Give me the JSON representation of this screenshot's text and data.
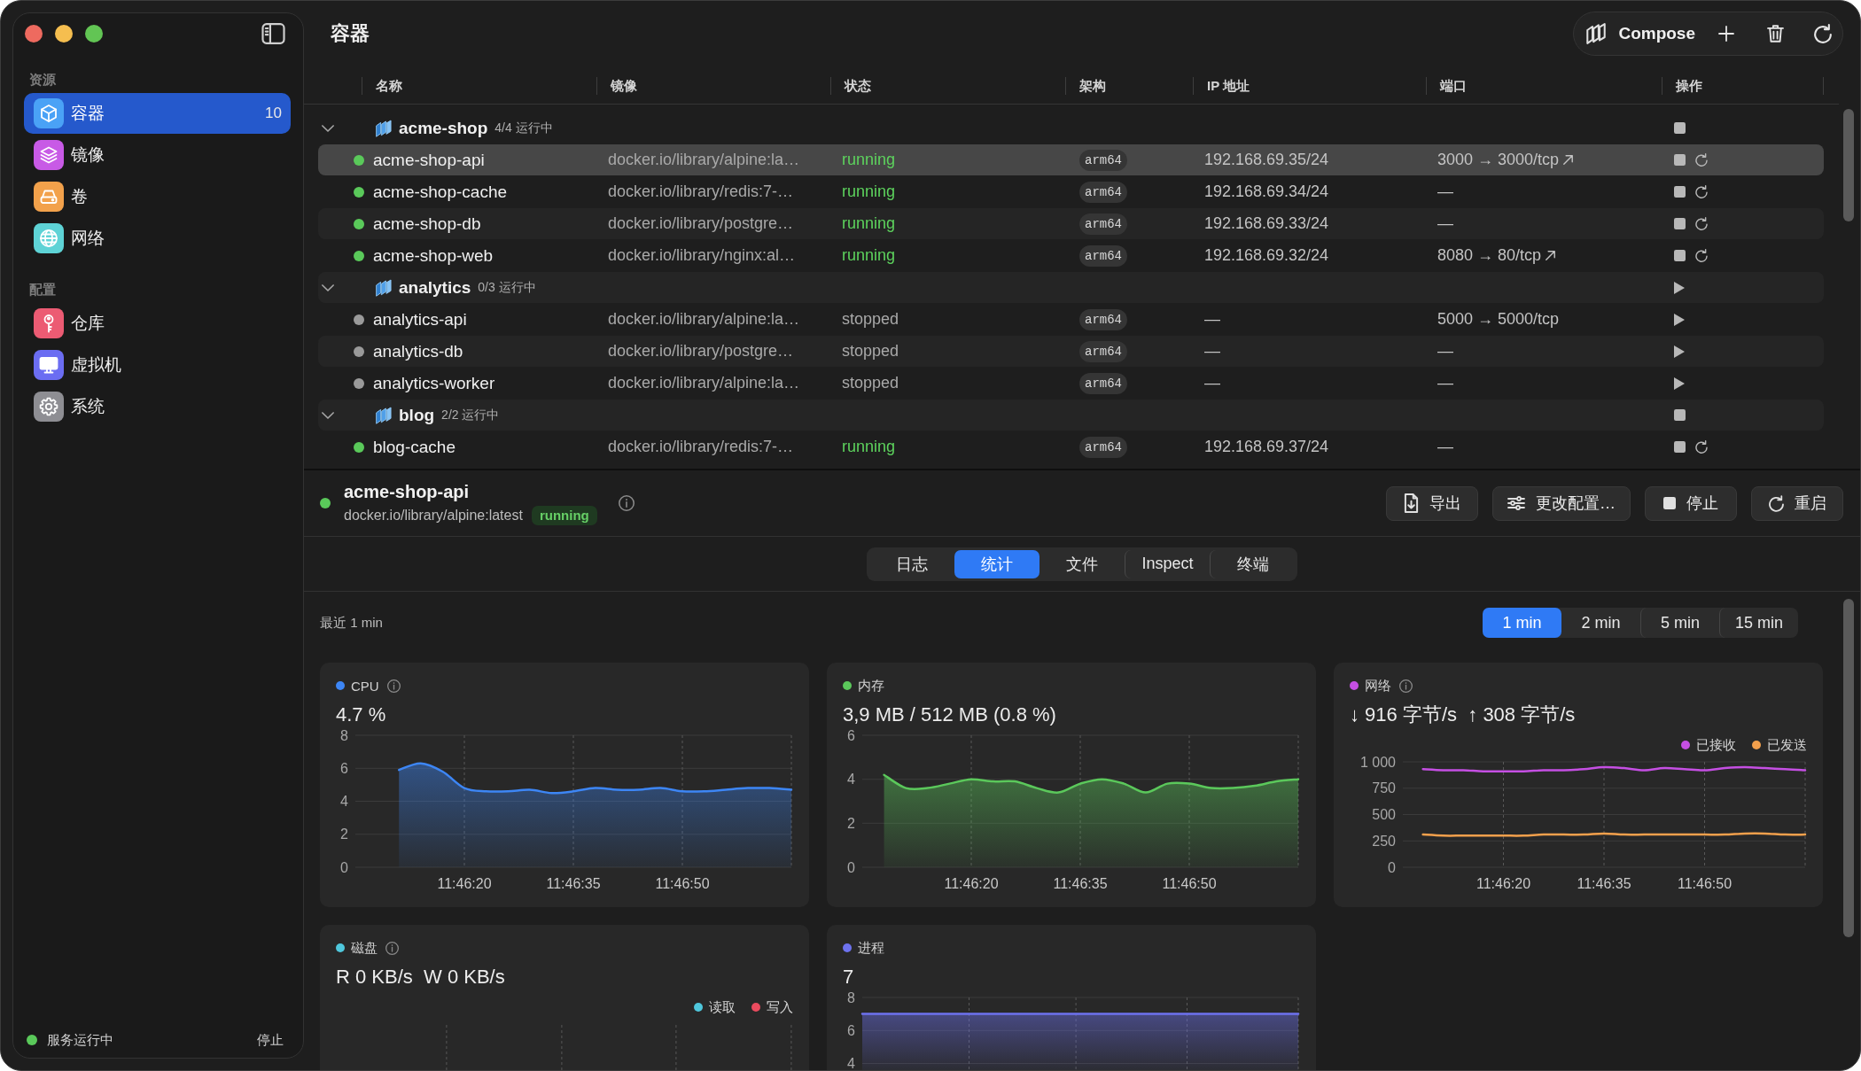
{
  "window": {
    "title": "容器"
  },
  "sidebar": {
    "sections": [
      {
        "label": "资源",
        "items": [
          {
            "label": "容器",
            "count": "10",
            "selected": true,
            "color": "#4aa2f6"
          },
          {
            "label": "镜像",
            "selected": false,
            "color": "#c85ae6"
          },
          {
            "label": "卷",
            "selected": false,
            "color": "#f2a14b"
          },
          {
            "label": "网络",
            "selected": false,
            "color": "#5ed3d6"
          }
        ]
      },
      {
        "label": "配置",
        "items": [
          {
            "label": "仓库",
            "selected": false,
            "color": "#ec5b73"
          },
          {
            "label": "虚拟机",
            "selected": false,
            "color": "#6b6df2"
          },
          {
            "label": "系统",
            "selected": false,
            "color": "#8e8e93"
          }
        ]
      }
    ],
    "status": {
      "text": "服务运行中",
      "running": true,
      "action": "停止"
    }
  },
  "toolbar": {
    "compose": "Compose"
  },
  "table": {
    "columns": [
      "名称",
      "镜像",
      "状态",
      "架构",
      "IP 地址",
      "端口",
      "操作"
    ],
    "groups": [
      {
        "name": "acme-shop",
        "summary": "4/4 运行中",
        "expanded": true,
        "running": true,
        "selected": false,
        "children": [
          {
            "name": "acme-shop-api",
            "image": "docker.io/library/alpine:la…",
            "status": "running",
            "running": true,
            "arch": "arm64",
            "ip": "192.168.69.35/24",
            "port": "3000 → 3000/tcp",
            "port_link": true,
            "selected": true
          },
          {
            "name": "acme-shop-cache",
            "image": "docker.io/library/redis:7-…",
            "status": "running",
            "running": true,
            "arch": "arm64",
            "ip": "192.168.69.34/24",
            "port": "—",
            "port_link": false,
            "selected": false
          },
          {
            "name": "acme-shop-db",
            "image": "docker.io/library/postgre…",
            "status": "running",
            "running": true,
            "arch": "arm64",
            "ip": "192.168.69.33/24",
            "port": "—",
            "port_link": false,
            "selected": false
          },
          {
            "name": "acme-shop-web",
            "image": "docker.io/library/nginx:al…",
            "status": "running",
            "running": true,
            "arch": "arm64",
            "ip": "192.168.69.32/24",
            "port": "8080 → 80/tcp",
            "port_link": true,
            "selected": false
          }
        ]
      },
      {
        "name": "analytics",
        "summary": "0/3 运行中",
        "expanded": true,
        "running": false,
        "selected": false,
        "children": [
          {
            "name": "analytics-api",
            "image": "docker.io/library/alpine:la…",
            "status": "stopped",
            "running": false,
            "arch": "arm64",
            "ip": "—",
            "port": "5000 → 5000/tcp",
            "port_link": false,
            "selected": false
          },
          {
            "name": "analytics-db",
            "image": "docker.io/library/postgre…",
            "status": "stopped",
            "running": false,
            "arch": "arm64",
            "ip": "—",
            "port": "—",
            "port_link": false,
            "selected": false
          },
          {
            "name": "analytics-worker",
            "image": "docker.io/library/alpine:la…",
            "status": "stopped",
            "running": false,
            "arch": "arm64",
            "ip": "—",
            "port": "—",
            "port_link": false,
            "selected": false
          }
        ]
      },
      {
        "name": "blog",
        "summary": "2/2 运行中",
        "expanded": true,
        "running": true,
        "selected": false,
        "children": [
          {
            "name": "blog-cache",
            "image": "docker.io/library/redis:7-…",
            "status": "running",
            "running": true,
            "arch": "arm64",
            "ip": "192.168.69.37/24",
            "port": "—",
            "port_link": false,
            "selected": false
          }
        ]
      }
    ]
  },
  "detail": {
    "name": "acme-shop-api",
    "image": "docker.io/library/alpine:latest",
    "status": "running",
    "running": true,
    "buttons": [
      "导出",
      "更改配置…",
      "停止",
      "重启"
    ]
  },
  "tabs": [
    {
      "label": "日志",
      "selected": false
    },
    {
      "label": "统计",
      "selected": true
    },
    {
      "label": "文件",
      "selected": false
    },
    {
      "label": "Inspect",
      "selected": false
    },
    {
      "label": "终端",
      "selected": false
    }
  ],
  "stats": {
    "caption": "最近 1 min",
    "ranges": [
      {
        "label": "1 min",
        "selected": true
      },
      {
        "label": "2 min",
        "selected": false
      },
      {
        "label": "5 min",
        "selected": false
      },
      {
        "label": "15 min",
        "selected": false
      }
    ],
    "cards": [
      {
        "label": "CPU",
        "color": "#3d86f5",
        "info": true,
        "value": "4.7 %",
        "chart_data": {
          "type": "area",
          "categories": [
            null,
            null,
            null,
            null,
            null,
            "11:46:20",
            null,
            null,
            null,
            null,
            "11:46:35",
            null,
            null,
            null,
            null,
            "11:46:50",
            null,
            null,
            null,
            null,
            null
          ],
          "values": [
            null,
            null,
            5.9,
            6.3,
            5.8,
            4.8,
            4.6,
            4.6,
            4.7,
            4.5,
            4.6,
            4.8,
            4.7,
            4.7,
            4.8,
            4.6,
            4.6,
            4.7,
            4.8,
            4.8,
            4.7
          ],
          "ylim": [
            0,
            8
          ],
          "yticks": [
            0,
            2,
            4,
            6,
            8
          ],
          "grid": true
        }
      },
      {
        "label": "内存",
        "color": "#5bc85b",
        "info": false,
        "value": "3,9 MB / 512 MB (0.8 %)",
        "chart_data": {
          "type": "area",
          "categories": [
            null,
            null,
            null,
            null,
            null,
            "11:46:20",
            null,
            null,
            null,
            null,
            "11:46:35",
            null,
            null,
            null,
            null,
            "11:46:50",
            null,
            null,
            null,
            null,
            null
          ],
          "values": [
            null,
            4.2,
            3.6,
            3.6,
            3.8,
            4.0,
            3.9,
            3.9,
            3.6,
            3.4,
            3.8,
            4.0,
            3.8,
            3.4,
            3.8,
            3.8,
            3.6,
            3.6,
            3.7,
            3.9,
            4.0
          ],
          "ylim": [
            0,
            6
          ],
          "yticks": [
            0,
            2,
            4,
            6
          ],
          "grid": true
        }
      },
      {
        "label": "网络",
        "color": "#c54fe3",
        "info": true,
        "value": "↓ 916 字节/s  ↑ 308 字节/s",
        "chart_data": {
          "type": "line",
          "categories": [
            null,
            null,
            null,
            null,
            null,
            "11:46:20",
            null,
            null,
            null,
            null,
            "11:46:35",
            null,
            null,
            null,
            null,
            "11:46:50",
            null,
            null,
            null,
            null,
            null
          ],
          "series": [
            {
              "name": "已接收",
              "color": "#c54fe3",
              "values": [
                null,
                930,
                920,
                920,
                910,
                910,
                910,
                920,
                920,
                930,
                950,
                940,
                920,
                940,
                930,
                920,
                940,
                950,
                940,
                930,
                920
              ]
            },
            {
              "name": "已发送",
              "color": "#f3a04c",
              "values": [
                null,
                310,
                300,
                300,
                300,
                300,
                300,
                310,
                310,
                310,
                320,
                310,
                310,
                310,
                310,
                310,
                310,
                320,
                320,
                310,
                310
              ]
            }
          ],
          "ylim": [
            0,
            1000
          ],
          "yticks": [
            0,
            250,
            500,
            750,
            {
              "value": 1000,
              "label": "1 000"
            }
          ],
          "grid": true
        }
      },
      {
        "label": "磁盘",
        "color": "#4fc7dc",
        "info": true,
        "value": "R 0 KB/s  W 0 KB/s",
        "legend": [
          {
            "label": "读取",
            "color": "#4fc7dc"
          },
          {
            "label": "写入",
            "color": "#ea4b5e"
          }
        ]
      },
      {
        "label": "进程",
        "color": "#6d72ee",
        "info": false,
        "value": "7",
        "chart_data": {
          "type": "area",
          "values": [
            7,
            7,
            7,
            7,
            7,
            7,
            7,
            7,
            7,
            7,
            7,
            7,
            7,
            7,
            7,
            7,
            7,
            7,
            7,
            7
          ],
          "ylim": [
            3.6,
            8
          ],
          "yticks": [
            4,
            6,
            8
          ],
          "grid": true
        }
      }
    ]
  }
}
